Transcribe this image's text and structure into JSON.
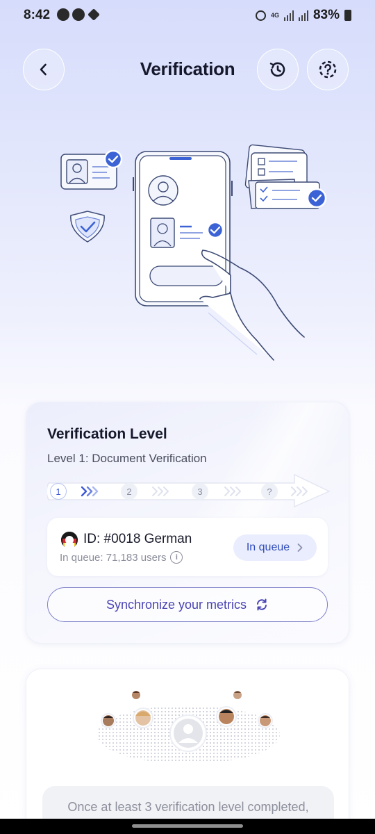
{
  "status": {
    "time": "8:42",
    "battery": "83%",
    "network": "4G"
  },
  "header": {
    "title": "Verification",
    "back_icon": "chevron-left-icon",
    "history_icon": "history-icon",
    "help_icon": "help-icon"
  },
  "level_card": {
    "title": "Verification Level",
    "subtitle": "Level 1: Document Verification",
    "steps": [
      "1",
      "2",
      "3",
      "?"
    ],
    "active_step": 1,
    "queue": {
      "id_text": "ID: #0018 German",
      "count_text": "In queue: 71,183 users",
      "status_label": "In queue"
    },
    "sync_label": "Synchronize your metrics"
  },
  "community_card": {
    "note": "Once at least 3 verification level completed,"
  },
  "colors": {
    "accent": "#3d57d8",
    "sync_text": "#4a44b3",
    "check_blue": "#3b63d6"
  }
}
